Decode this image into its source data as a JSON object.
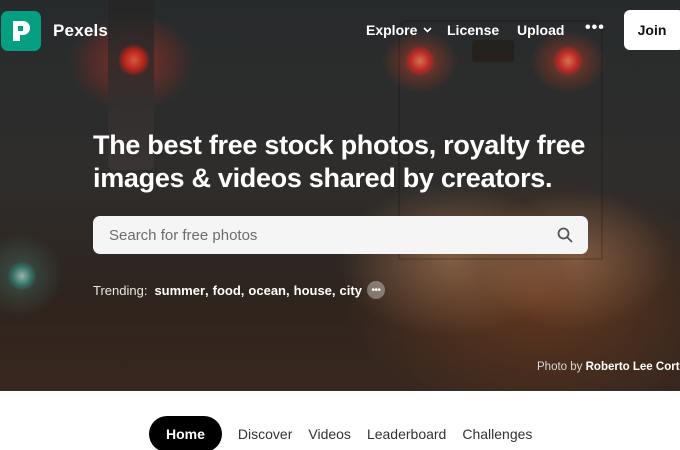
{
  "header": {
    "brand_name": "Pexels",
    "logo_icon": "pexels-logo-icon",
    "nav": {
      "explore": "Explore",
      "license": "License",
      "upload": "Upload",
      "more": "•••"
    },
    "join_label": "Join"
  },
  "hero": {
    "headline_line1": "The best free stock photos, royalty free",
    "headline_line2": "images & videos shared by creators.",
    "search": {
      "placeholder": "Search for free photos",
      "value": ""
    },
    "trending": {
      "label": "Trending:",
      "terms": [
        "summer",
        "food",
        "ocean",
        "house",
        "city"
      ]
    },
    "credit": {
      "prefix": "Photo by",
      "author": "Roberto Lee Corte"
    }
  },
  "tabs": {
    "items": [
      "Home",
      "Discover",
      "Videos",
      "Leaderboard",
      "Challenges"
    ],
    "active": "Home"
  },
  "colors": {
    "brand": "#05a081",
    "active_tab_bg": "#000000"
  }
}
